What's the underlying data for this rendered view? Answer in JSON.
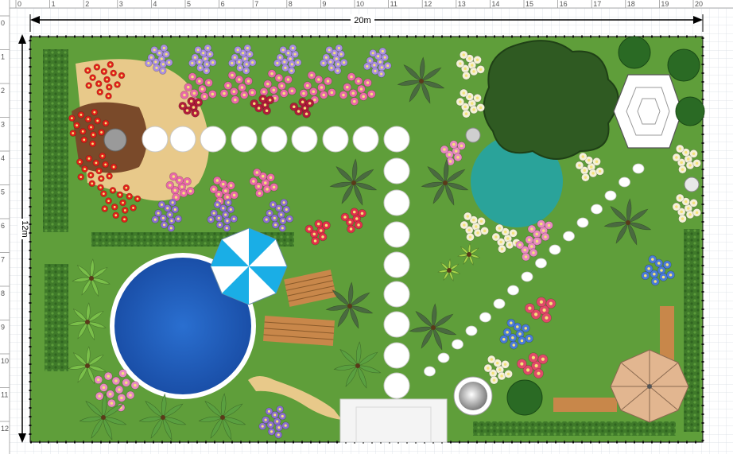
{
  "ruler": {
    "top_ticks": [
      "0",
      "1",
      "2",
      "3",
      "4",
      "5",
      "6",
      "7",
      "8",
      "9",
      "10",
      "11",
      "12",
      "13",
      "14",
      "15",
      "16",
      "17",
      "18",
      "19",
      "20"
    ],
    "left_ticks": [
      "0",
      "1",
      "2",
      "3",
      "4",
      "5",
      "6",
      "7",
      "8",
      "9",
      "10",
      "11",
      "12"
    ]
  },
  "dimensions": {
    "width_label": "20m",
    "height_label": "12m"
  },
  "colors": {
    "lawn": "#5f9e3a",
    "hedge": "#3f7a2a",
    "pool": "#1f5fbf",
    "pond": "#2aa39a",
    "path": "#e8c98a",
    "stone": "#ffffff",
    "deck": "#c8874a",
    "fence": "#111111"
  },
  "icons": {
    "pool": "swimming-pool-icon",
    "pond": "pond-icon",
    "umbrella_blue": "patio-umbrella-icon",
    "umbrella_tan": "patio-umbrella-icon",
    "gazebo": "gazebo-icon",
    "palm": "palm-tree-icon",
    "fountain": "fountain-icon",
    "bench": "bench-icon"
  }
}
